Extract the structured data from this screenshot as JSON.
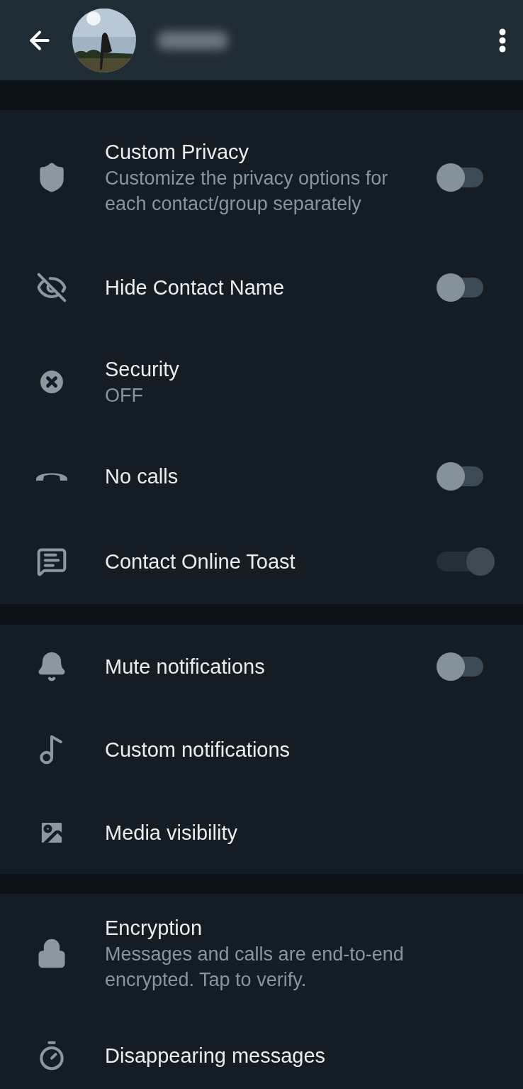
{
  "header": {
    "name_redacted": true
  },
  "sections": [
    {
      "items": [
        {
          "kind": "toggle",
          "title": "Custom Privacy",
          "subtitle": "Customize the privacy options for each contact/group separately",
          "on": false,
          "disabled": false
        },
        {
          "kind": "toggle",
          "title": "Hide Contact Name",
          "on": false,
          "disabled": false
        },
        {
          "kind": "plain",
          "title": "Security",
          "subtitle": "OFF"
        },
        {
          "kind": "toggle",
          "title": "No calls",
          "on": false,
          "disabled": false
        },
        {
          "kind": "toggle",
          "title": "Contact Online Toast",
          "on": true,
          "disabled": true
        }
      ]
    },
    {
      "items": [
        {
          "kind": "toggle",
          "title": "Mute notifications",
          "on": false,
          "disabled": false
        },
        {
          "kind": "plain",
          "title": "Custom notifications"
        },
        {
          "kind": "plain",
          "title": "Media visibility"
        }
      ]
    },
    {
      "items": [
        {
          "kind": "plain",
          "title": "Encryption",
          "subtitle": "Messages and calls are end-to-end encrypted. Tap to verify."
        },
        {
          "kind": "plain",
          "title": "Disappearing messages"
        }
      ]
    }
  ]
}
